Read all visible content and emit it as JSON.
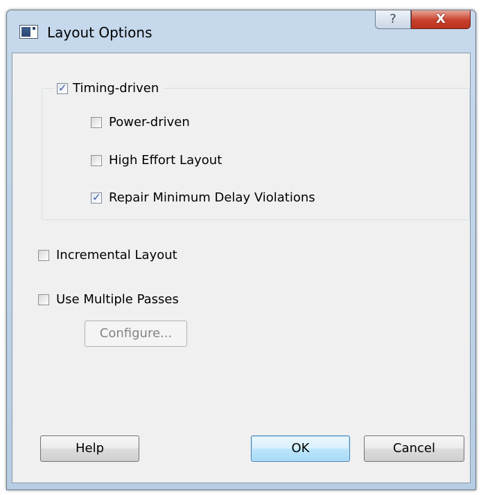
{
  "window": {
    "title": "Layout Options",
    "help_glyph": "?",
    "close_glyph": "X"
  },
  "options": {
    "timing_driven": {
      "label": "Timing-driven",
      "checked": true
    },
    "power_driven": {
      "label": "Power-driven",
      "checked": false
    },
    "high_effort": {
      "label": "High Effort Layout",
      "checked": false
    },
    "repair_min_delay": {
      "label": "Repair Minimum Delay Violations",
      "checked": true
    },
    "incremental": {
      "label": "Incremental Layout",
      "checked": false
    },
    "multiple_passes": {
      "label": "Use Multiple Passes",
      "checked": false
    }
  },
  "buttons": {
    "configure": "Configure...",
    "help": "Help",
    "ok": "OK",
    "cancel": "Cancel"
  },
  "check_glyph": "✓"
}
